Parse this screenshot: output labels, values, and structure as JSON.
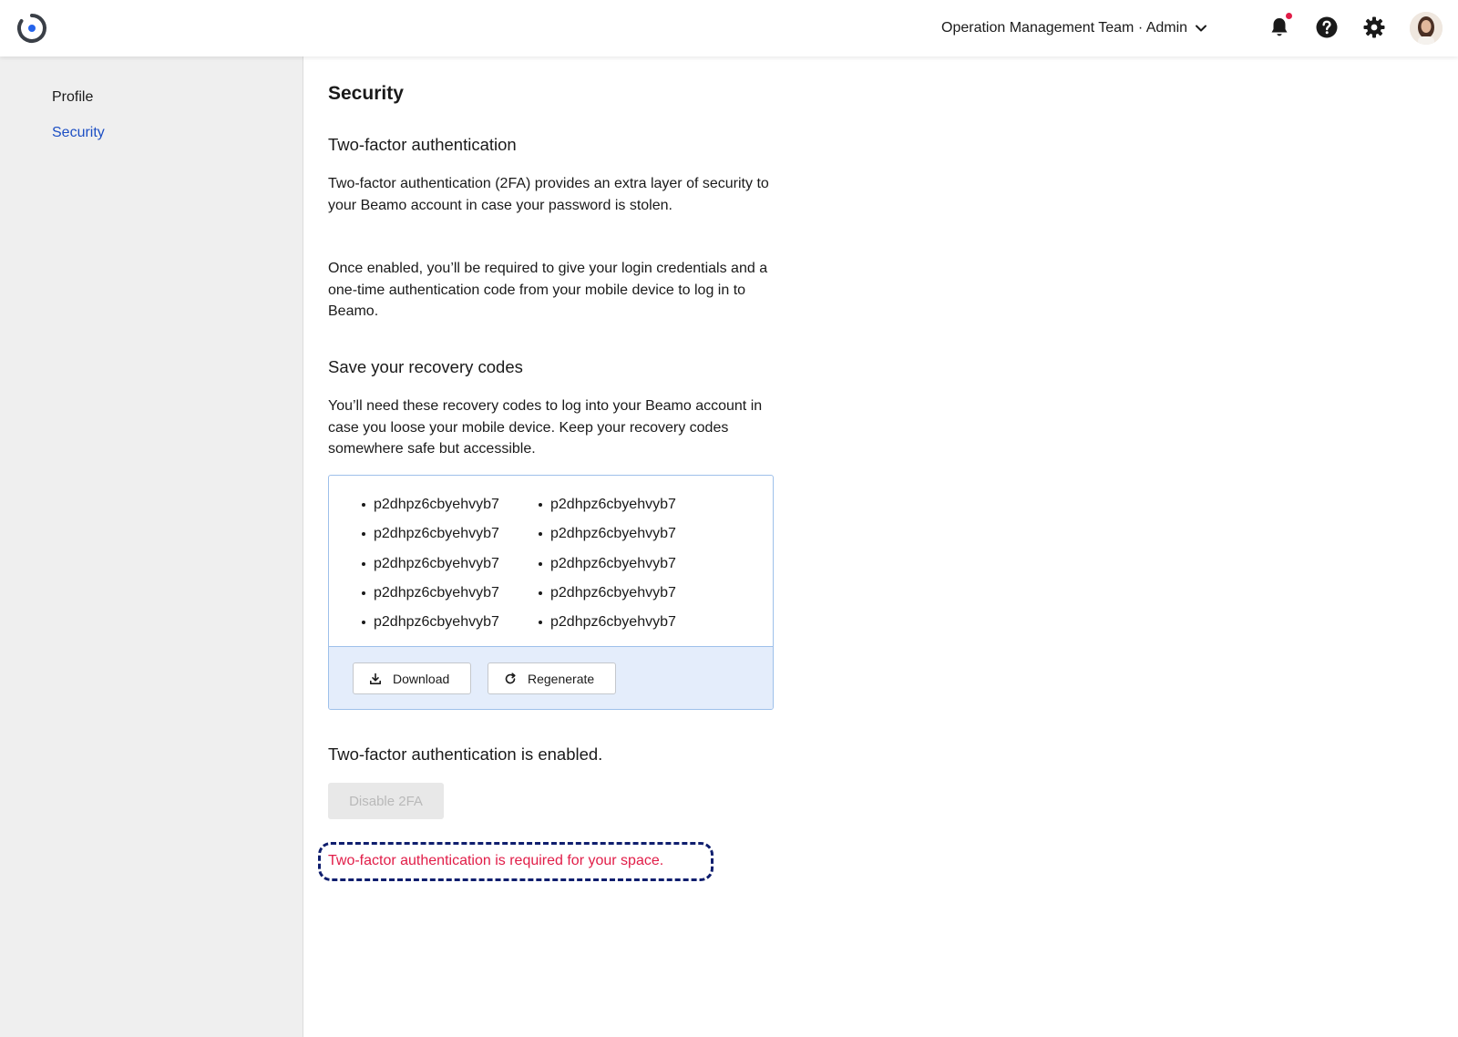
{
  "header": {
    "team_label": "Operation Management Team · Admin",
    "notification_dot_color": "#e11d48",
    "icons": [
      "logo-icon",
      "chevron-down-icon",
      "bell-icon",
      "help-icon",
      "gear-icon",
      "avatar"
    ]
  },
  "sidebar": {
    "items": [
      {
        "label": "Profile",
        "active": false
      },
      {
        "label": "Security",
        "active": true
      }
    ]
  },
  "main": {
    "title": "Security",
    "twofa": {
      "heading": "Two-factor authentication",
      "para1": "Two-factor authentication (2FA) provides an extra layer of security to your Beamo account in case your password is stolen.",
      "para2": "Once enabled, you’ll be required to give your login credentials and a one-time authentication code from your mobile device to log in to Beamo."
    },
    "recovery": {
      "heading": "Save your recovery codes",
      "para": "You’ll need these recovery codes to log into your Beamo account in case you loose your mobile device. Keep your recovery codes somewhere safe but accessible.",
      "codes": [
        "p2dhpz6cbyehvyb7",
        "p2dhpz6cbyehvyb7",
        "p2dhpz6cbyehvyb7",
        "p2dhpz6cbyehvyb7",
        "p2dhpz6cbyehvyb7",
        "p2dhpz6cbyehvyb7",
        "p2dhpz6cbyehvyb7",
        "p2dhpz6cbyehvyb7",
        "p2dhpz6cbyehvyb7",
        "p2dhpz6cbyehvyb7"
      ],
      "download_label": "Download",
      "regenerate_label": "Regenerate"
    },
    "status": {
      "enabled_text": "Two-factor authentication is enabled.",
      "disable_label": "Disable 2FA",
      "required_text": "Two-factor authentication is required for your space."
    }
  },
  "colors": {
    "accent": "#1d4fc4",
    "error": "#e11d48",
    "codes_border": "#9ec0ea",
    "codes_footer_bg": "#e4edfb"
  }
}
